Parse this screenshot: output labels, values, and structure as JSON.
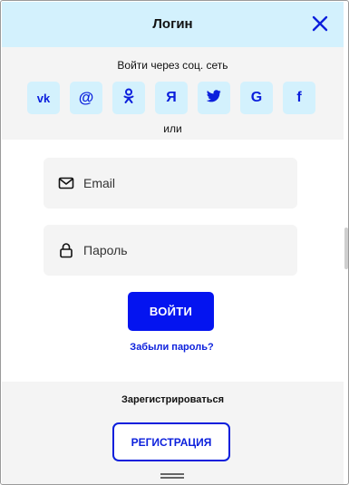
{
  "header": {
    "title": "Логин",
    "close_icon": "close-icon"
  },
  "social": {
    "caption": "Войти через соц. сеть",
    "buttons": [
      {
        "id": "vk",
        "glyph": "vk",
        "icon": "vk-icon"
      },
      {
        "id": "mail",
        "glyph": "@",
        "icon": "mail-ru-icon"
      },
      {
        "id": "ok",
        "glyph": "",
        "icon": "odnoklassniki-icon"
      },
      {
        "id": "yandex",
        "glyph": "Я",
        "icon": "yandex-icon"
      },
      {
        "id": "twitter",
        "glyph": "",
        "icon": "twitter-icon"
      },
      {
        "id": "google",
        "glyph": "G",
        "icon": "google-icon"
      },
      {
        "id": "facebook",
        "glyph": "f",
        "icon": "facebook-icon"
      }
    ],
    "or_text": "или"
  },
  "form": {
    "email": {
      "placeholder": "Email",
      "value": "",
      "icon": "envelope-icon"
    },
    "password": {
      "placeholder": "Пароль",
      "value": "",
      "icon": "lock-icon"
    },
    "login_label": "ВОЙТИ",
    "forgot_label": "Забыли пароль?"
  },
  "register": {
    "caption": "Зарегистрироваться",
    "button_label": "РЕГИСТРАЦИЯ"
  },
  "colors": {
    "accent": "#0414f0",
    "link": "#0b1fdc",
    "header_bg": "#d3f1fd",
    "social_btn_bg": "#d3f1fd",
    "section_bg": "#f4f4f4"
  }
}
